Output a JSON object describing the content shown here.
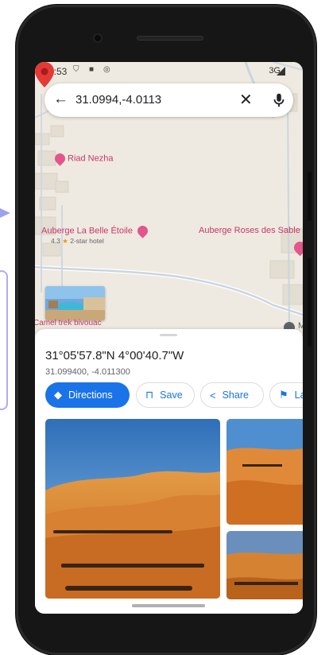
{
  "status_bar": {
    "time": "4:53",
    "network": "3G"
  },
  "search": {
    "query": "31.0994,-4.0113"
  },
  "map": {
    "labels": [
      {
        "name": "Riad Nezha"
      },
      {
        "name": "Auberge La Belle Étoile",
        "rating": "4.3",
        "detail": "2-star hotel"
      },
      {
        "name": "Auberge Roses des Sable"
      },
      {
        "name": "Camel trek bivouac"
      }
    ],
    "compass_label": "M"
  },
  "place": {
    "title": "31°05'57.8\"N 4°00'40.7\"W",
    "subtitle": "31.099400, -4.011300"
  },
  "actions": [
    {
      "label": "Directions",
      "icon": "directions-icon"
    },
    {
      "label": "Save",
      "icon": "bookmark-icon"
    },
    {
      "label": "Share",
      "icon": "share-icon"
    },
    {
      "label": "La",
      "icon": "flag-icon"
    }
  ],
  "colors": {
    "accent": "#1a73e8",
    "poi": "#e4558b",
    "pin": "#e53935",
    "map_bg": "#efeae1"
  }
}
